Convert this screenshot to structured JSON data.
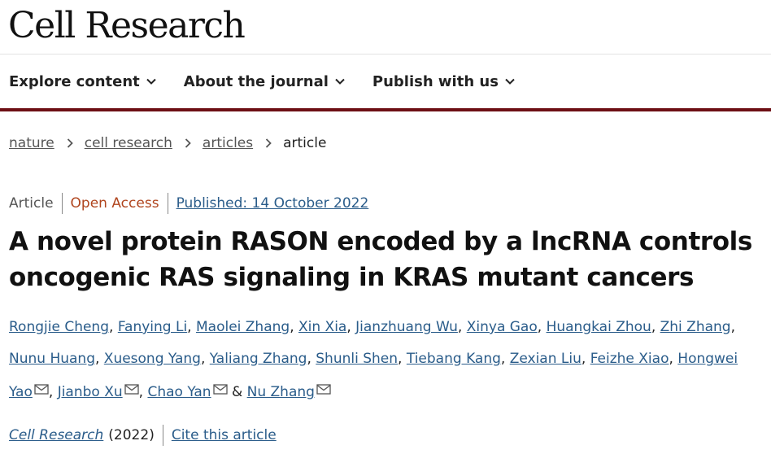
{
  "header": {
    "logo": "Cell Research"
  },
  "nav": {
    "items": [
      {
        "label": "Explore content",
        "icon": "chevron-down-icon"
      },
      {
        "label": "About the journal",
        "icon": "chevron-down-icon"
      },
      {
        "label": "Publish with us",
        "icon": "chevron-down-icon"
      }
    ]
  },
  "breadcrumb": {
    "items": [
      "nature",
      "cell research",
      "articles"
    ],
    "current": "article",
    "separator_icon": "chevron-right-icon"
  },
  "article": {
    "type": "Article",
    "access": "Open Access",
    "published": "Published: 14 October 2022",
    "title": "A novel protein RASON encoded by a lncRNA controls oncogenic RAS signaling in KRAS mutant cancers",
    "authors": [
      {
        "name": "Rongjie Cheng",
        "email": false
      },
      {
        "name": "Fanying Li",
        "email": false
      },
      {
        "name": "Maolei Zhang",
        "email": false
      },
      {
        "name": "Xin Xia",
        "email": false
      },
      {
        "name": "Jianzhuang Wu",
        "email": false
      },
      {
        "name": "Xinya Gao",
        "email": false
      },
      {
        "name": "Huangkai Zhou",
        "email": false
      },
      {
        "name": "Zhi Zhang",
        "email": false
      },
      {
        "name": "Nunu Huang",
        "email": false
      },
      {
        "name": "Xuesong Yang",
        "email": false
      },
      {
        "name": "Yaliang Zhang",
        "email": false
      },
      {
        "name": "Shunli Shen",
        "email": false
      },
      {
        "name": "Tiebang Kang",
        "email": false
      },
      {
        "name": "Zexian Liu",
        "email": false
      },
      {
        "name": "Feizhe Xiao",
        "email": false
      },
      {
        "name": "Hongwei Yao",
        "email": true
      },
      {
        "name": "Jianbo Xu",
        "email": true
      },
      {
        "name": "Chao Yan",
        "email": true
      },
      {
        "name": "Nu Zhang",
        "email": true
      }
    ],
    "author_separator": ",",
    "last_author_joiner": "&",
    "email_icon": "envelope-icon"
  },
  "citation": {
    "journal": "Cell Research",
    "year": "(2022)",
    "cite_label": "Cite this article"
  },
  "colors": {
    "nav_border": "#6d0f14",
    "link": "#2a5c8a",
    "open_access": "#b0451e",
    "text": "#222222"
  }
}
